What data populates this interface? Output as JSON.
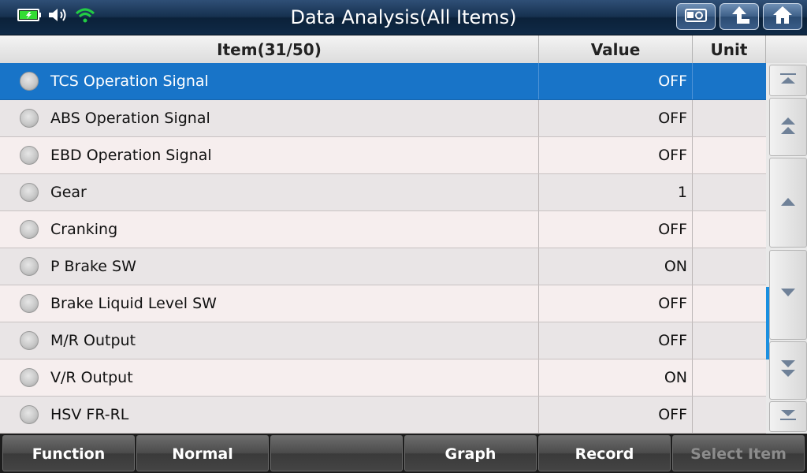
{
  "header": {
    "title": "Data Analysis(All Items)",
    "buttons": {
      "screenshot_icon": "camera-icon",
      "back_icon": "back-arrow-icon",
      "home_icon": "home-icon"
    },
    "status_icons": [
      "battery-charging-icon",
      "volume-icon",
      "wifi-icon"
    ]
  },
  "table": {
    "columns": {
      "item": "Item(31/50)",
      "value": "Value",
      "unit": "Unit"
    },
    "selected_index": 0,
    "rows": [
      {
        "item": "TCS Operation Signal",
        "value": "OFF",
        "unit": ""
      },
      {
        "item": "ABS Operation Signal",
        "value": "OFF",
        "unit": ""
      },
      {
        "item": "EBD Operation Signal",
        "value": "OFF",
        "unit": ""
      },
      {
        "item": "Gear",
        "value": "1",
        "unit": ""
      },
      {
        "item": "Cranking",
        "value": "OFF",
        "unit": ""
      },
      {
        "item": "P Brake SW",
        "value": "ON",
        "unit": ""
      },
      {
        "item": "Brake Liquid Level SW",
        "value": "OFF",
        "unit": ""
      },
      {
        "item": "M/R Output",
        "value": "OFF",
        "unit": ""
      },
      {
        "item": "V/R Output",
        "value": "ON",
        "unit": ""
      },
      {
        "item": "HSV FR-RL",
        "value": "OFF",
        "unit": ""
      }
    ]
  },
  "footer": {
    "buttons": [
      {
        "label": "Function",
        "enabled": true
      },
      {
        "label": "Normal",
        "enabled": true
      },
      {
        "label": "",
        "enabled": true
      },
      {
        "label": "Graph",
        "enabled": true
      },
      {
        "label": "Record",
        "enabled": true
      },
      {
        "label": "Select Item",
        "enabled": false
      }
    ]
  },
  "colors": {
    "selected_row": "#1874c8",
    "titlebar": "#16314f",
    "wifi": "#22cc44",
    "battery": "#33dd33",
    "scroll_thumb": "#1a8fe0"
  }
}
